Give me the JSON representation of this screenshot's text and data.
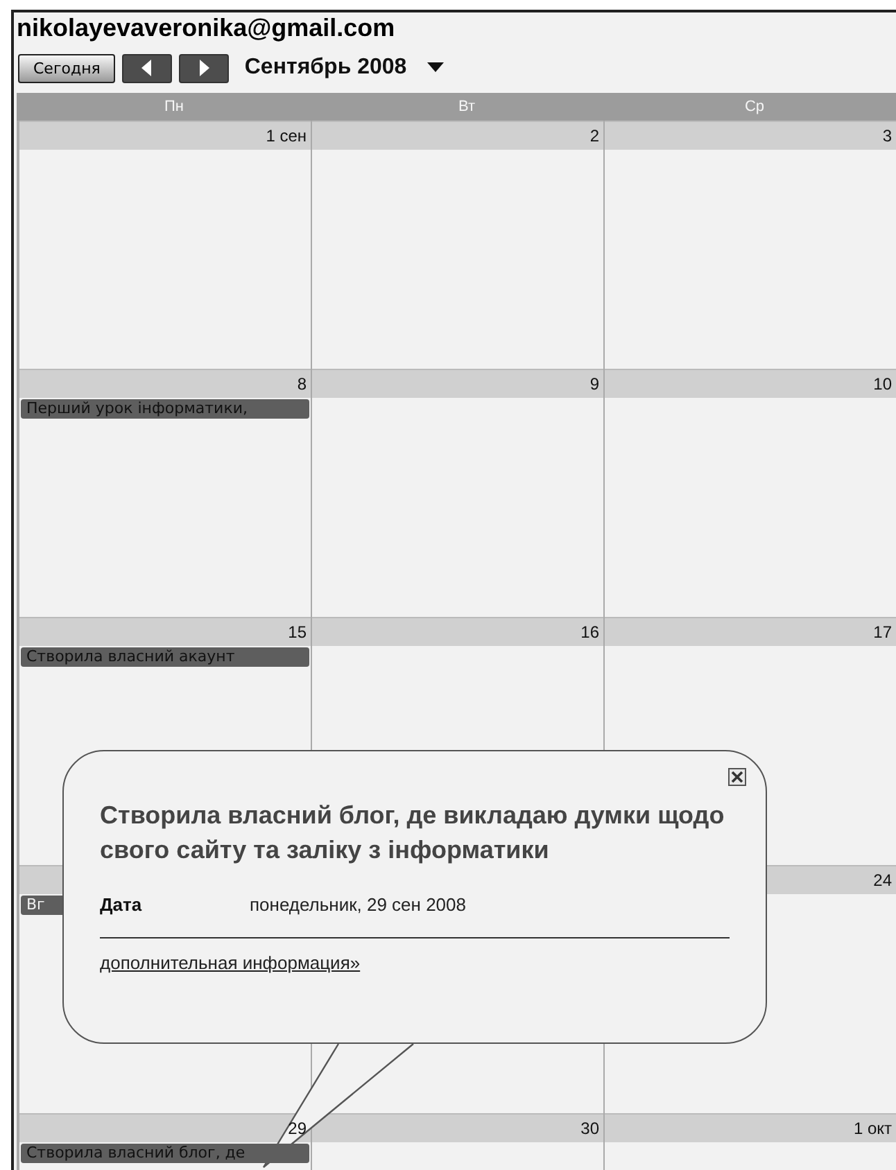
{
  "account": "nikolayevaveronika@gmail.com",
  "toolbar": {
    "today_button": "Сегодня",
    "month_label": "Сентябрь 2008"
  },
  "weekdays": [
    "Пн",
    "Вт",
    "Ср"
  ],
  "weeks": [
    {
      "days": [
        {
          "kind": "day",
          "date": "1 сен"
        },
        {
          "kind": "day",
          "date": "2"
        },
        {
          "kind": "day",
          "date": "3"
        }
      ]
    },
    {
      "days": [
        {
          "kind": "day",
          "date": "8",
          "events": [
            "Перший урок інформатики,"
          ]
        },
        {
          "kind": "day",
          "date": "9"
        },
        {
          "kind": "day",
          "date": "10"
        }
      ]
    },
    {
      "days": [
        {
          "kind": "day",
          "date": "15",
          "events": [
            "Створила власний акаунт"
          ]
        },
        {
          "kind": "day",
          "date": "16"
        },
        {
          "kind": "day",
          "date": "17"
        }
      ]
    },
    {
      "days": [
        {
          "kind": "day",
          "events": [
            "Вг"
          ]
        },
        {
          "kind": "covered"
        },
        {
          "kind": "day",
          "date": "24"
        }
      ]
    },
    {
      "days": [
        {
          "kind": "day",
          "date": "29",
          "events": [
            "Створила власний блог, де"
          ]
        },
        {
          "kind": "day",
          "date": "30"
        },
        {
          "kind": "day",
          "date": "1 окт"
        }
      ]
    }
  ],
  "popup": {
    "title": "Створила власний блог, де викладаю думки щодо свого сайту та заліку з інформатики",
    "field_label": "Дата",
    "field_value": "понедельник, 29 сен 2008",
    "link": "дополнительная информация»"
  }
}
